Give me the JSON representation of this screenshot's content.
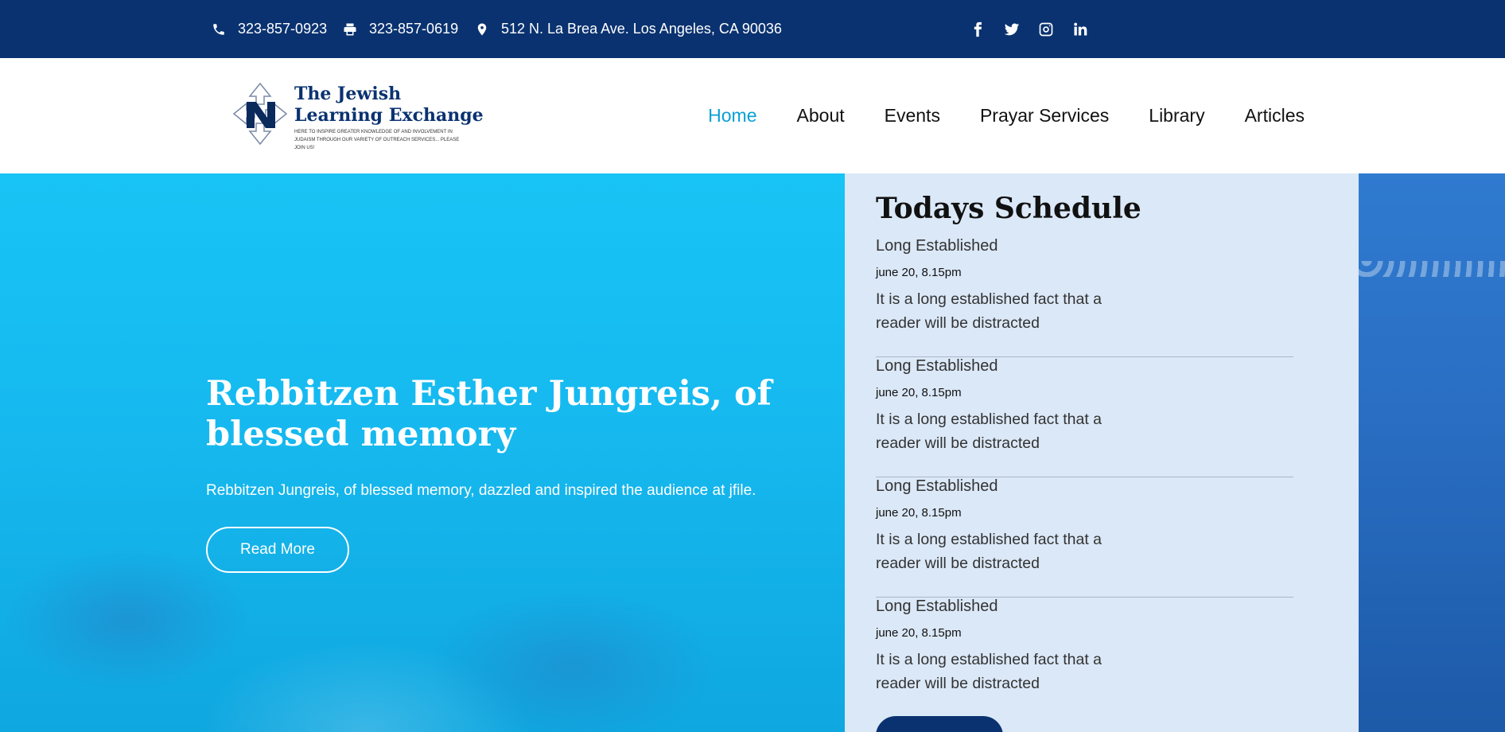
{
  "topbar": {
    "phone": "323-857-0923",
    "fax": "323-857-0619",
    "address": "512 N. La Brea Ave. Los Angeles, CA 90036",
    "icons": [
      "phone-icon",
      "printer-icon",
      "location-pin-icon"
    ],
    "social": [
      "facebook-icon",
      "twitter-icon",
      "instagram-icon",
      "linkedin-icon"
    ],
    "background": "#0a3270"
  },
  "logo": {
    "title_line1": "The Jewish",
    "title_line2": "Learning Exchange",
    "tagline": "HERE TO INSPIRE GREATER KNOWLEDGE OF AND INVOLVEMENT IN JUDAISM THROUGH OUR VARIETY OF OUTREACH SERVICES... PLEASE JOIN US!"
  },
  "nav": {
    "items": [
      "Home",
      "About",
      "Events",
      "Prayar Services",
      "Library",
      "Articles"
    ],
    "active_color": "#0aa0d6"
  },
  "hero": {
    "title": "Rebbitzen Esther Jungreis, of blessed memory",
    "description": "Rebbitzen Jungreis, of blessed memory, dazzled and inspired the audience at jfile.",
    "button": "Read More",
    "color": "#18c4f5"
  },
  "schedule": {
    "title": "Todays Schedule",
    "background": "#dbe8f7",
    "items": [
      {
        "title": "Long Established",
        "date": "june 20, 8.15pm",
        "description": "It is a long established fact that a reader will be distracted"
      },
      {
        "title": "Long Established",
        "date": "june 20, 8.15pm",
        "description": "It is a long established fact that a reader will be distracted"
      },
      {
        "title": "Long Established",
        "date": "june 20, 8.15pm",
        "description": "It is a long established fact that a reader will be distracted"
      },
      {
        "title": "Long Established",
        "date": "june 20, 8.15pm",
        "description": "It is a long established fact that a reader will be distracted"
      }
    ]
  }
}
